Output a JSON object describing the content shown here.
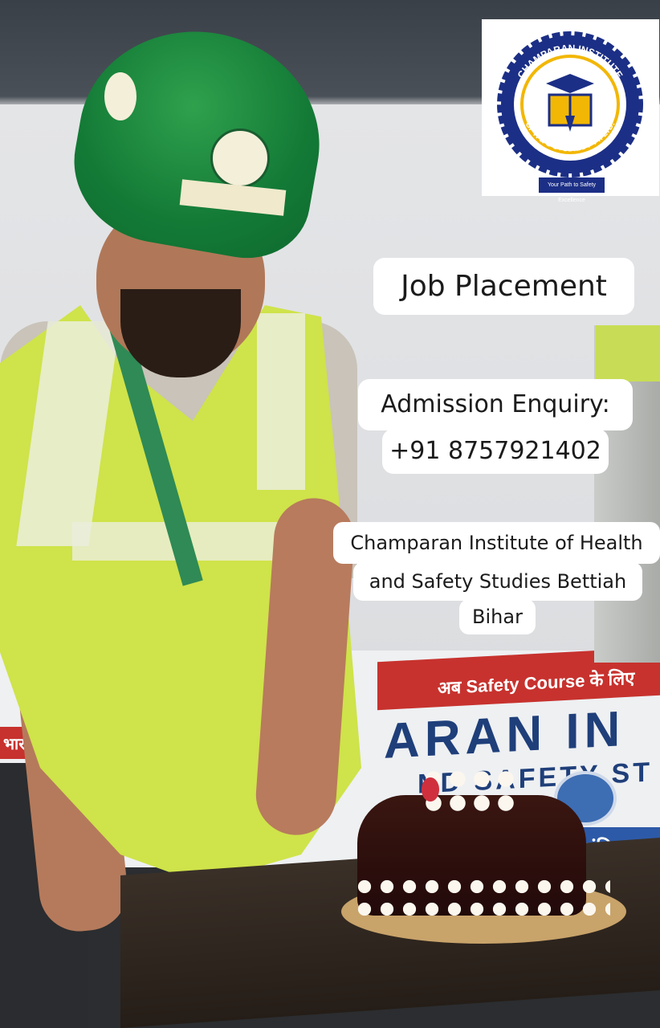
{
  "logo": {
    "ring_text_top": "CHAMPARAN INSTITUTE",
    "ring_text_bottom": "OF H & S STUDIES PVT. LTD.",
    "tagline": "Your Path to Safety Excellence",
    "colors": {
      "navy": "#1c2f86",
      "gold": "#f2b705",
      "white": "#ffffff"
    }
  },
  "overlay": {
    "job_placement": "Job Placement",
    "admission_label": "Admission Enquiry:",
    "admission_phone": "+91 8757921402",
    "institute_line1": "Champaran Institute of Health",
    "institute_line2": "and Safety Studies Bettiah",
    "institute_line3": "Bihar"
  },
  "banner": {
    "red_strip": "अब Safety Course के लिए",
    "left_strip": "भारत",
    "big_text": "ARAN IN",
    "small_text": "ND SAFETY ST",
    "blue_strip": "इंडि"
  }
}
